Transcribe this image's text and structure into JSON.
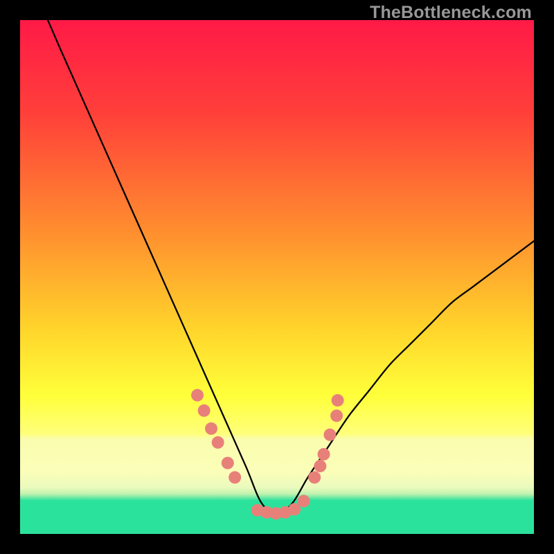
{
  "watermark": "TheBottleneck.com",
  "chart_data": {
    "type": "line",
    "title": "",
    "xlabel": "",
    "ylabel": "",
    "xlim": [
      0,
      100
    ],
    "ylim": [
      0,
      100
    ],
    "grid": false,
    "gradient_stops": [
      {
        "pct": 0,
        "color": "#ff1a47"
      },
      {
        "pct": 18,
        "color": "#ff3f3a"
      },
      {
        "pct": 40,
        "color": "#ff8a2f"
      },
      {
        "pct": 60,
        "color": "#ffd42b"
      },
      {
        "pct": 73,
        "color": "#ffff3a"
      },
      {
        "pct": 80.5,
        "color": "#ffff7a"
      },
      {
        "pct": 81.5,
        "color": "#fafdae"
      },
      {
        "pct": 88,
        "color": "#fbfeb8"
      },
      {
        "pct": 91,
        "color": "#eafabd"
      },
      {
        "pct": 92.2,
        "color": "#c2f2ae"
      },
      {
        "pct": 93.5,
        "color": "#2be29d"
      },
      {
        "pct": 100,
        "color": "#2be29d"
      }
    ],
    "series": [
      {
        "name": "bottleneck-curve",
        "x": [
          0,
          4,
          8,
          12,
          16,
          20,
          24,
          28,
          32,
          36,
          40,
          44,
          47,
          50,
          53,
          56,
          60,
          64,
          68,
          72,
          76,
          80,
          84,
          88,
          92,
          96,
          100
        ],
        "values": [
          110,
          103,
          94,
          85,
          76,
          67,
          58,
          49,
          40,
          31,
          22,
          13,
          6,
          4,
          6,
          11,
          17,
          23,
          28,
          33,
          37,
          41,
          45,
          48,
          51,
          54,
          57
        ]
      }
    ],
    "annotations": {
      "dot_clusters": [
        {
          "name": "left-cluster",
          "points": [
            {
              "x": 34.5,
              "y": 27.0
            },
            {
              "x": 35.8,
              "y": 24.0
            },
            {
              "x": 37.2,
              "y": 20.5
            },
            {
              "x": 38.5,
              "y": 17.8
            },
            {
              "x": 40.4,
              "y": 13.8
            },
            {
              "x": 41.8,
              "y": 11.0
            }
          ]
        },
        {
          "name": "bottom-cluster",
          "points": [
            {
              "x": 46.2,
              "y": 4.6
            },
            {
              "x": 48.0,
              "y": 4.2
            },
            {
              "x": 49.8,
              "y": 4.0
            },
            {
              "x": 51.6,
              "y": 4.2
            },
            {
              "x": 53.4,
              "y": 4.8
            },
            {
              "x": 55.2,
              "y": 6.4
            }
          ]
        },
        {
          "name": "right-cluster",
          "points": [
            {
              "x": 57.3,
              "y": 11.0
            },
            {
              "x": 58.4,
              "y": 13.2
            },
            {
              "x": 59.1,
              "y": 15.5
            },
            {
              "x": 60.3,
              "y": 19.3
            },
            {
              "x": 61.6,
              "y": 23.0
            },
            {
              "x": 61.8,
              "y": 26.0
            }
          ]
        }
      ]
    }
  }
}
